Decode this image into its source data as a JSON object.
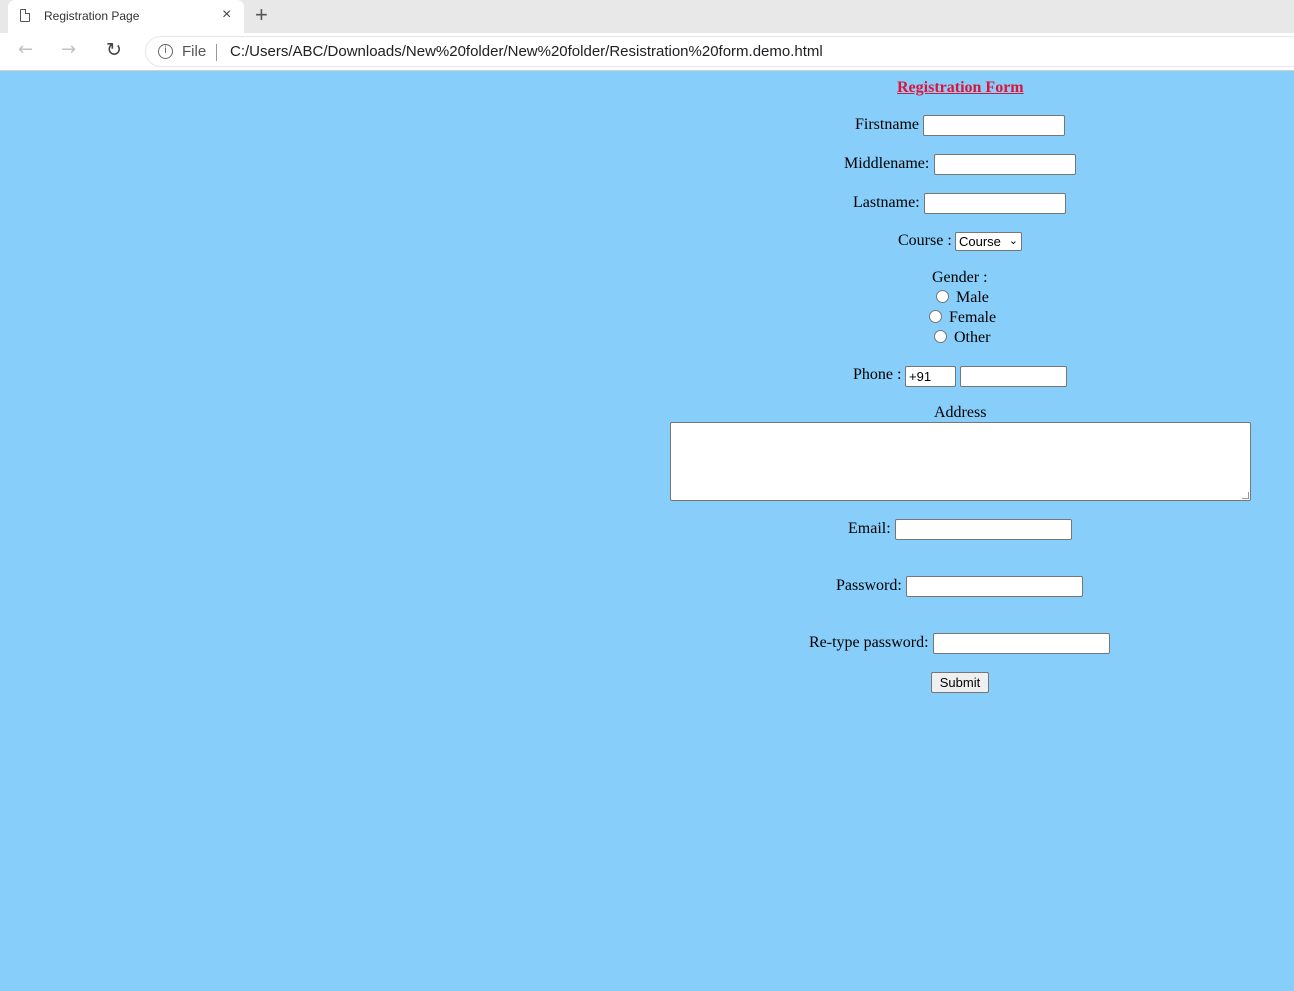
{
  "browser": {
    "tab_title": "Registration Page",
    "tab_close": "×",
    "new_tab": "+",
    "back": "←",
    "forward": "→",
    "reload": "↻",
    "info": "i",
    "scheme": "File",
    "url": "C:/Users/ABC/Downloads/New%20folder/New%20folder/Resistration%20form.demo.html"
  },
  "form": {
    "title": "Registration Form",
    "firstname_label": "Firstname",
    "middlename_label": "Middlename:",
    "lastname_label": "Lastname:",
    "course_label": "Course :",
    "course_selected": "Course",
    "gender_label": "Gender :",
    "gender_options": [
      "Male",
      "Female",
      "Other"
    ],
    "phone_label": "Phone :",
    "phone_code": "+91",
    "address_label": "Address",
    "email_label": "Email:",
    "password_label": "Password:",
    "retype_label": "Re-type password:",
    "submit_label": "Submit"
  },
  "colors": {
    "page_background": "#87cefa",
    "title_color": "#dc143c"
  }
}
